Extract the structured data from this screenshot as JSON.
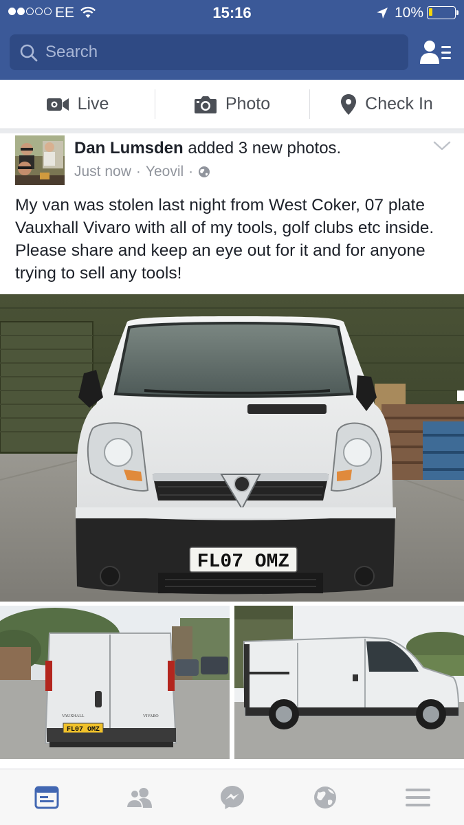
{
  "status_bar": {
    "carrier": "EE",
    "time": "15:16",
    "battery": "10%",
    "battery_level": 0.1
  },
  "header": {
    "search_placeholder": "Search",
    "icons": [
      "search-icon",
      "friends-list-icon"
    ]
  },
  "composer": {
    "live": "Live",
    "photo": "Photo",
    "check_in": "Check In"
  },
  "post": {
    "author": "Dan Lumsden",
    "action": "added 3 new photos.",
    "time": "Just now",
    "location": "Yeovil",
    "separator": "·",
    "text": "My van was stolen last night from West Coker, 07 plate Vauxhall Vivaro with all of my tools, golf clubs etc inside. Please share and keep an eye out for it and for anyone trying to sell any tools!",
    "photos": {
      "main_plate": "FL07 OMZ",
      "rear_plate": "FL07 OMZ",
      "rear_badge_left": "VAUXHALL",
      "rear_badge_right": "VIVARO"
    }
  },
  "tabbar": {
    "items": [
      "news-feed-icon",
      "friend-requests-icon",
      "messenger-icon",
      "notifications-globe-icon",
      "menu-icon"
    ],
    "active": "news-feed-icon",
    "active_color": "#4267b2",
    "inactive_color": "#b0b3b8"
  }
}
